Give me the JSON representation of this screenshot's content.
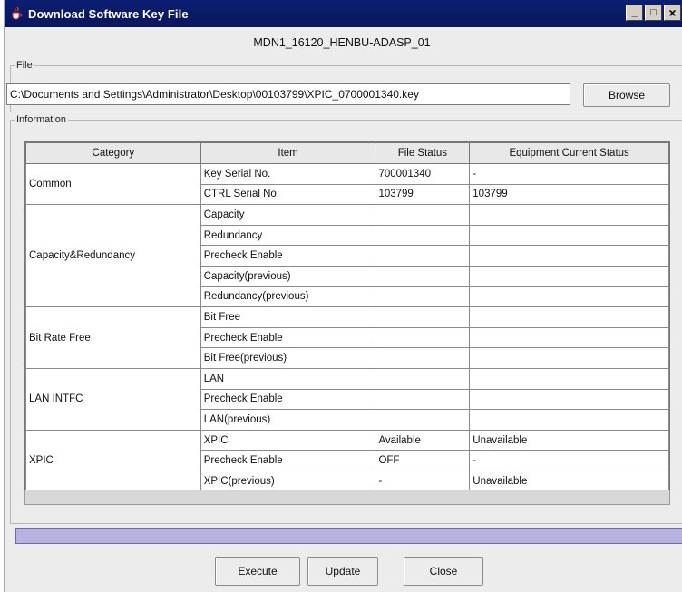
{
  "window": {
    "title": "Download Software Key File",
    "controls": {
      "minimize": "_",
      "maximize": "□",
      "close": "×"
    }
  },
  "header": {
    "title": "MDN1_16120_HENBU-ADASP_01"
  },
  "file_group": {
    "legend": "File",
    "path": "C:\\Documents and Settings\\Administrator\\Desktop\\00103799\\XPIC_0700001340.key",
    "browse_label": "Browse"
  },
  "info_group": {
    "legend": "Information"
  },
  "table": {
    "columns": [
      "Category",
      "Item",
      "File Status",
      "Equipment Current Status"
    ],
    "groups": [
      {
        "category": "Common",
        "rows": [
          {
            "item": "Key Serial No.",
            "file_status": "700001340",
            "equipment_status": "-"
          },
          {
            "item": "CTRL Serial No.",
            "file_status": "103799",
            "equipment_status": "103799"
          }
        ]
      },
      {
        "category": "Capacity&Redundancy",
        "rows": [
          {
            "item": "Capacity",
            "file_status": "",
            "equipment_status": ""
          },
          {
            "item": "Redundancy",
            "file_status": "",
            "equipment_status": ""
          },
          {
            "item": "Precheck Enable",
            "file_status": "",
            "equipment_status": ""
          },
          {
            "item": "Capacity(previous)",
            "file_status": "",
            "equipment_status": ""
          },
          {
            "item": "Redundancy(previous)",
            "file_status": "",
            "equipment_status": ""
          }
        ]
      },
      {
        "category": "Bit Rate Free",
        "rows": [
          {
            "item": "Bit Free",
            "file_status": "",
            "equipment_status": ""
          },
          {
            "item": "Precheck Enable",
            "file_status": "",
            "equipment_status": ""
          },
          {
            "item": "Bit Free(previous)",
            "file_status": "",
            "equipment_status": ""
          }
        ]
      },
      {
        "category": "LAN INTFC",
        "rows": [
          {
            "item": "LAN",
            "file_status": "",
            "equipment_status": ""
          },
          {
            "item": "Precheck Enable",
            "file_status": "",
            "equipment_status": ""
          },
          {
            "item": "LAN(previous)",
            "file_status": "",
            "equipment_status": ""
          }
        ]
      },
      {
        "category": "XPIC",
        "rows": [
          {
            "item": "XPIC",
            "file_status": "Available",
            "equipment_status": "Unavailable"
          },
          {
            "item": "Precheck Enable",
            "file_status": "OFF",
            "equipment_status": "-"
          },
          {
            "item": "XPIC(previous)",
            "file_status": "-",
            "equipment_status": "Unavailable"
          }
        ]
      }
    ]
  },
  "buttons": {
    "execute": "Execute",
    "update": "Update",
    "close": "Close"
  },
  "icons": {
    "title_icon": "java-cup-icon"
  },
  "colors": {
    "titlebar": "#0c1f73",
    "progress": "#b7b3e0",
    "window_bg": "#ececec"
  }
}
